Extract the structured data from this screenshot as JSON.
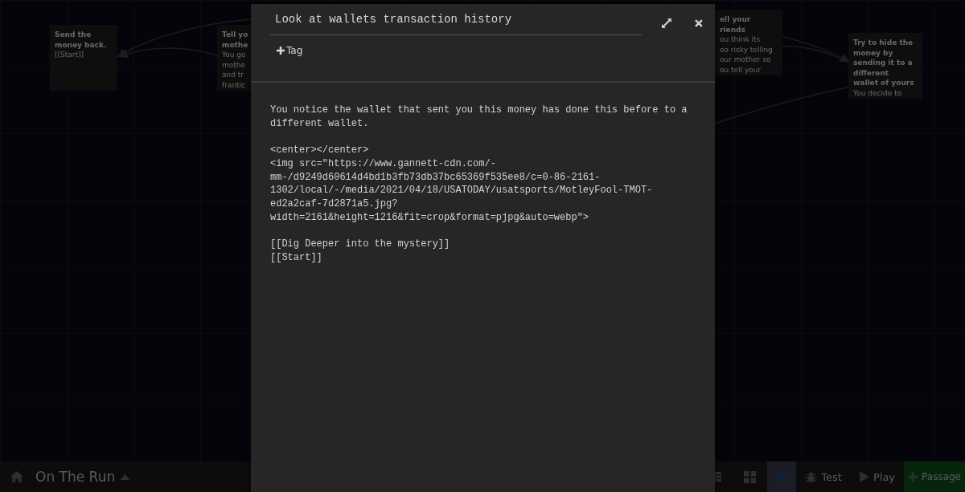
{
  "story_map": {
    "passages": [
      {
        "title_lines": [
          "Send the",
          "money back."
        ],
        "excerpt_lines": [
          "[[Start]]"
        ]
      },
      {
        "title_lines": [
          "Tell yo",
          "mothe"
        ],
        "excerpt_lines": [
          "You go",
          "mothe",
          "and tr",
          "frantic"
        ]
      },
      {
        "title_lines": [
          "ell your",
          "riends"
        ],
        "excerpt_lines": [
          "ou think its",
          "oo risky telling",
          "our mother so",
          "ou tell your"
        ]
      },
      {
        "title_lines": [
          "Try to hide the",
          "money by",
          "sending it to a",
          "different",
          "wallet of yours"
        ],
        "excerpt_lines": [
          "You decide to"
        ]
      }
    ]
  },
  "dialog": {
    "name": "Look at wallets transaction history",
    "add_tag": "Tag",
    "text": "You notice the wallet that sent you this money has done this before to a different wallet.\n\n<center></center>\n<img src=\"https://www.gannett-cdn.com/-mm-/d9249d60614d4bd1b3fb73db37bc65369f535ee8/c=0-86-2161-1302/local/-/media/2021/04/18/USATODAY/usatsports/MotleyFool-TMOT-ed2a2caf-7d2871a5.jpg?width=2161&height=1216&fit=crop&format=pjpg&auto=webp\">\n\n[[Dig Deeper into the mystery]]\n[[Start]]"
  },
  "toolbar": {
    "story_title": "On The Run",
    "buttons": [
      {
        "kind": "list",
        "selected": false
      },
      {
        "kind": "grid",
        "selected": false
      },
      {
        "kind": "zoom",
        "selected": true
      },
      {
        "kind": "test",
        "label": "Test",
        "selected": false
      },
      {
        "kind": "play",
        "label": "Play",
        "selected": false
      },
      {
        "kind": "passage",
        "label": "Passage",
        "selected": false
      }
    ]
  }
}
